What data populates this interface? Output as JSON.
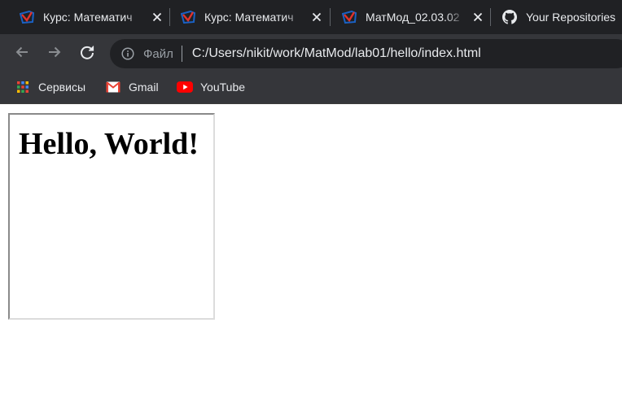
{
  "tabs": [
    {
      "title": "Курс: Математич",
      "icon": "moodle-favicon-icon"
    },
    {
      "title": "Курс: Математич",
      "icon": "moodle-favicon-icon"
    },
    {
      "title": "МатМод_02.03.02",
      "icon": "moodle-favicon-icon"
    },
    {
      "title": "Your Repositories",
      "icon": "github-icon"
    }
  ],
  "toolbar": {
    "security_chip": "Файл",
    "url": "C:/Users/nikit/work/MatMod/lab01/hello/index.html"
  },
  "bookmarks": [
    {
      "label": "Сервисы",
      "icon": "apps-grid-icon"
    },
    {
      "label": "Gmail",
      "icon": "gmail-icon"
    },
    {
      "label": "YouTube",
      "icon": "youtube-icon"
    }
  ],
  "page": {
    "heading": "Hello, World!"
  },
  "colors": {
    "tabstrip_bg": "#202124",
    "toolbar_bg": "#35363a",
    "omnibox_bg": "#202124",
    "text_light": "#e8eaed",
    "text_muted": "#9aa0a6",
    "moodle_red": "#e0322b",
    "moodle_blue": "#1a61c4"
  }
}
